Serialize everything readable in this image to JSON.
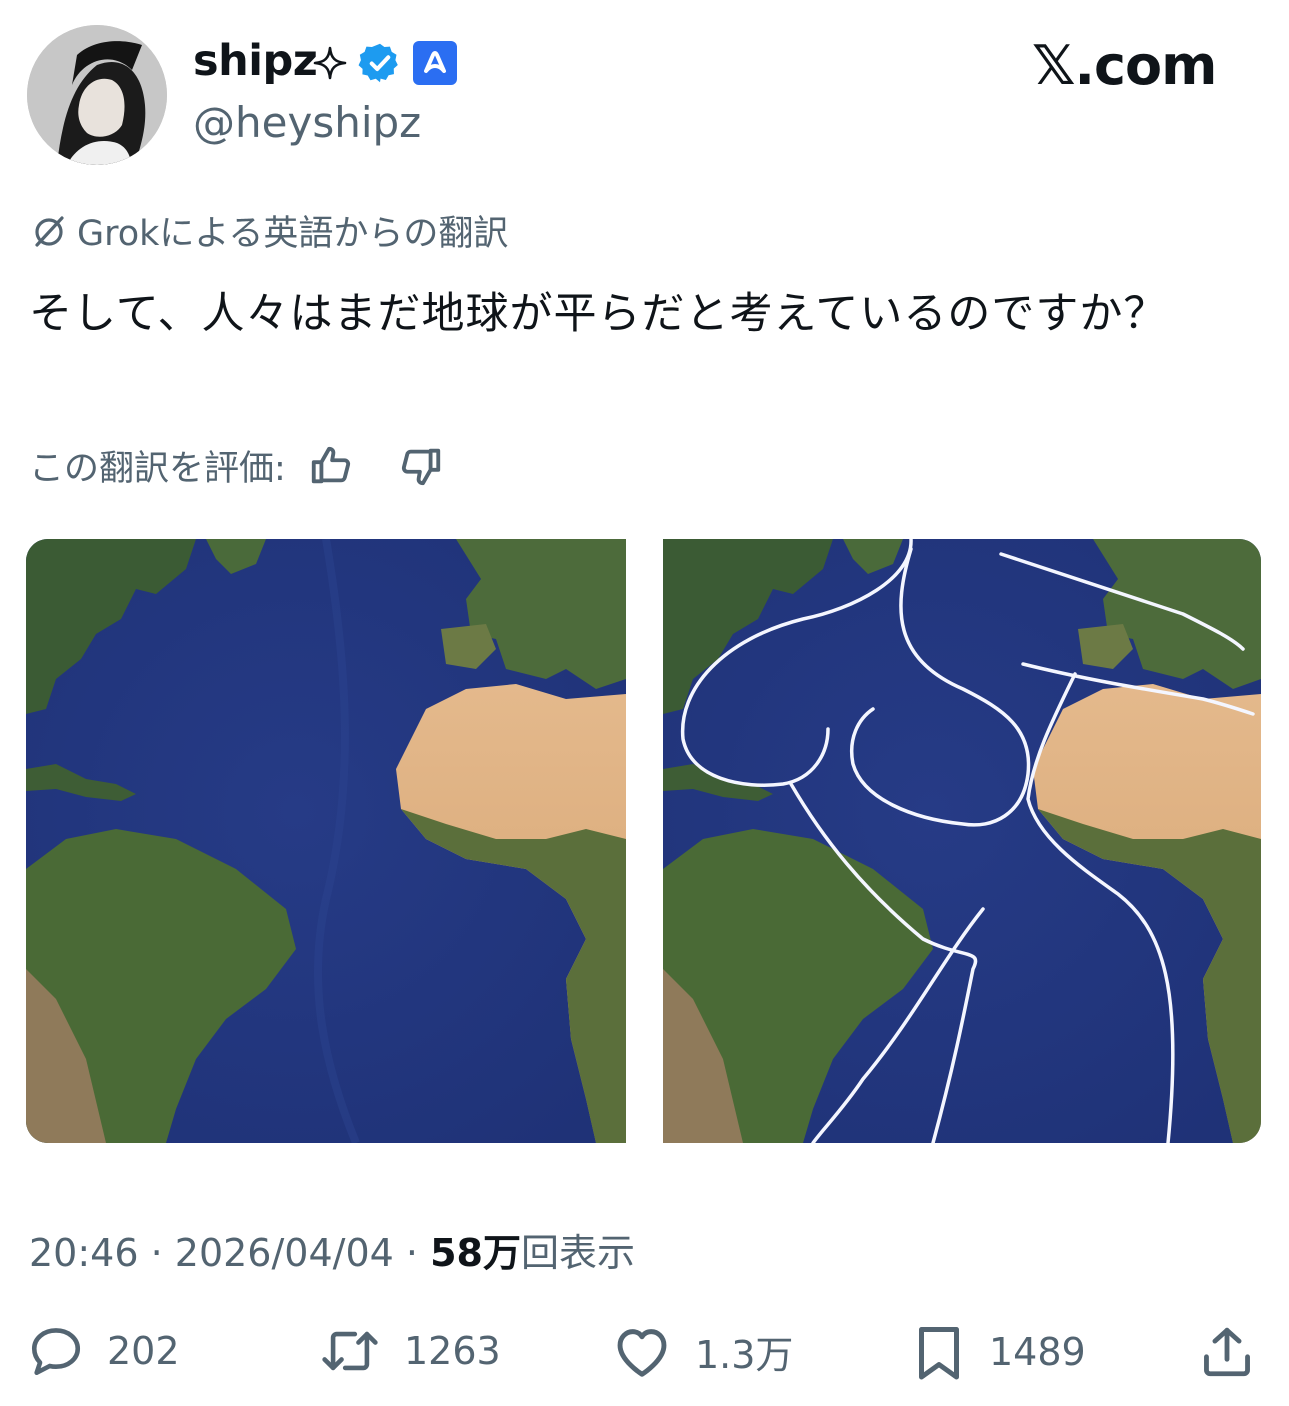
{
  "author": {
    "display_name": "shipz",
    "handle": "@heyshipz",
    "colors": {
      "verified_blue": "#1d9bf0",
      "app_badge_blue": "#2b6ef2"
    },
    "icons": [
      "sparkle-icon",
      "verified-badge-icon",
      "app-badge-icon"
    ]
  },
  "site": {
    "label": "𝕏.com"
  },
  "translation": {
    "label": "Grokによる英語からの翻訳",
    "text": "そして、人々はまだ地球が平らだと考えているのですか？",
    "rate_label": "この翻訳を評価:"
  },
  "media": {
    "count": 2,
    "icons": [
      "satellite-map-image",
      "satellite-map-outline-image"
    ]
  },
  "meta": {
    "time": "20:46",
    "date": "2026/04/04",
    "views_count": "58万",
    "views_label": "回表示"
  },
  "actions": {
    "replies": "202",
    "reposts": "1263",
    "likes": "1.3万",
    "bookmarks": "1489"
  }
}
